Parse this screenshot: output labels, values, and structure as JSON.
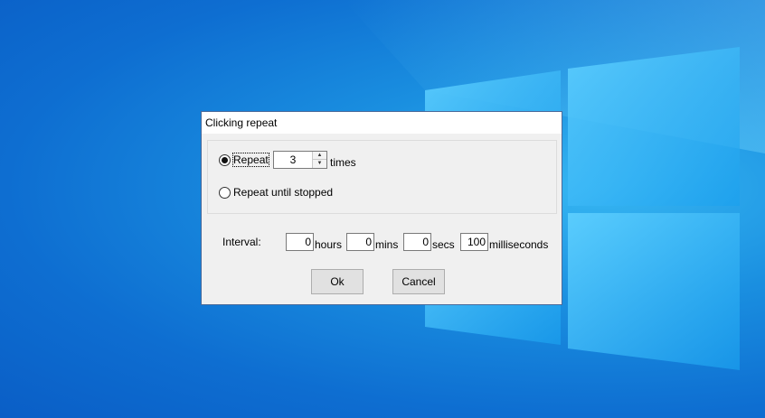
{
  "dialog": {
    "title": "Clicking repeat",
    "repeat_option": {
      "label": "Repeat",
      "selected": true
    },
    "repeat_count": {
      "value": "3",
      "suffix": "times"
    },
    "until_stopped_option": {
      "label": "Repeat until stopped",
      "selected": false
    },
    "interval": {
      "label": "Interval:",
      "hours": {
        "value": "0",
        "unit": "hours"
      },
      "mins": {
        "value": "0",
        "unit": "mins"
      },
      "secs": {
        "value": "0",
        "unit": "secs"
      },
      "milliseconds": {
        "value": "100",
        "unit": "milliseconds"
      }
    },
    "ok_label": "Ok",
    "cancel_label": "Cancel"
  },
  "colors": {
    "desktop_blue": "#0e6ed1",
    "logo_light": "#4cc7ff",
    "dialog_bg": "#f0f0f0",
    "button_bg": "#e1e1e1"
  }
}
